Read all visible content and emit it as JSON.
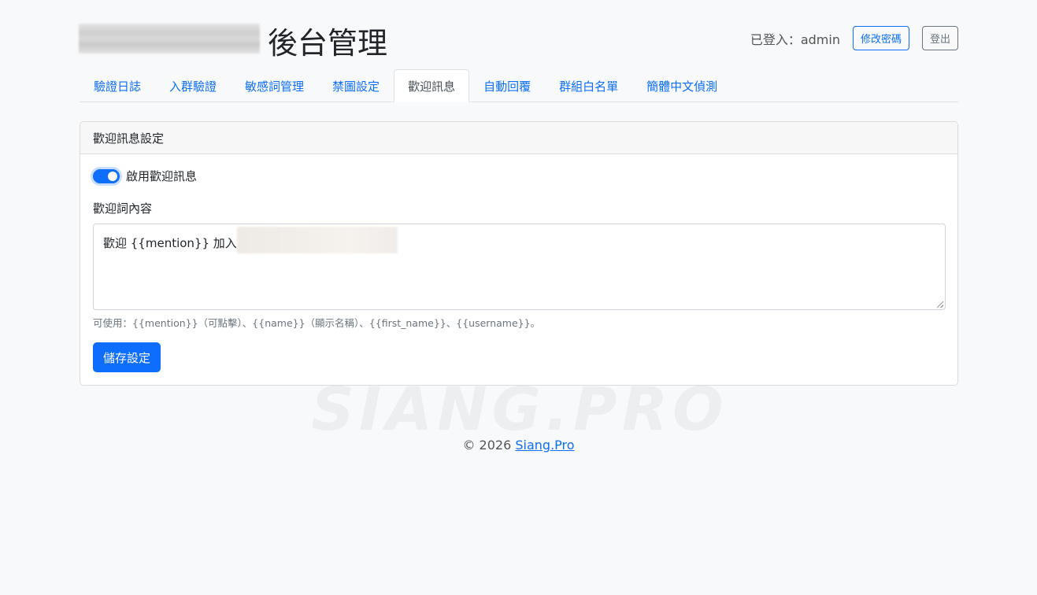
{
  "header": {
    "title": "後台管理",
    "login_status": "已登入：admin",
    "change_password_label": "修改密碼",
    "logout_label": "登出"
  },
  "tabs": [
    {
      "label": "驗證日誌",
      "active": false
    },
    {
      "label": "入群驗證",
      "active": false
    },
    {
      "label": "敏感詞管理",
      "active": false
    },
    {
      "label": "禁圖設定",
      "active": false
    },
    {
      "label": "歡迎訊息",
      "active": true
    },
    {
      "label": "自動回覆",
      "active": false
    },
    {
      "label": "群組白名單",
      "active": false
    },
    {
      "label": "簡體中文偵測",
      "active": false
    }
  ],
  "card": {
    "title": "歡迎訊息設定",
    "enable_switch_label": "啟用歡迎訊息",
    "enable_switch_on": true,
    "content_label": "歡迎詞內容",
    "content_value": "歡迎 {{mention}} 加入",
    "help_text": "可使用：{{mention}}（可點擊）、{{name}}（顯示名稱）、{{first_name}}、{{username}}。",
    "save_label": "儲存設定"
  },
  "footer": {
    "copyright": "© 2026",
    "link_text": "Siang.Pro"
  },
  "watermark": {
    "text": "SIANG.PRO"
  },
  "colors": {
    "primary": "#0d6efd",
    "secondary": "#6c757d",
    "background": "#f8f9fa"
  }
}
